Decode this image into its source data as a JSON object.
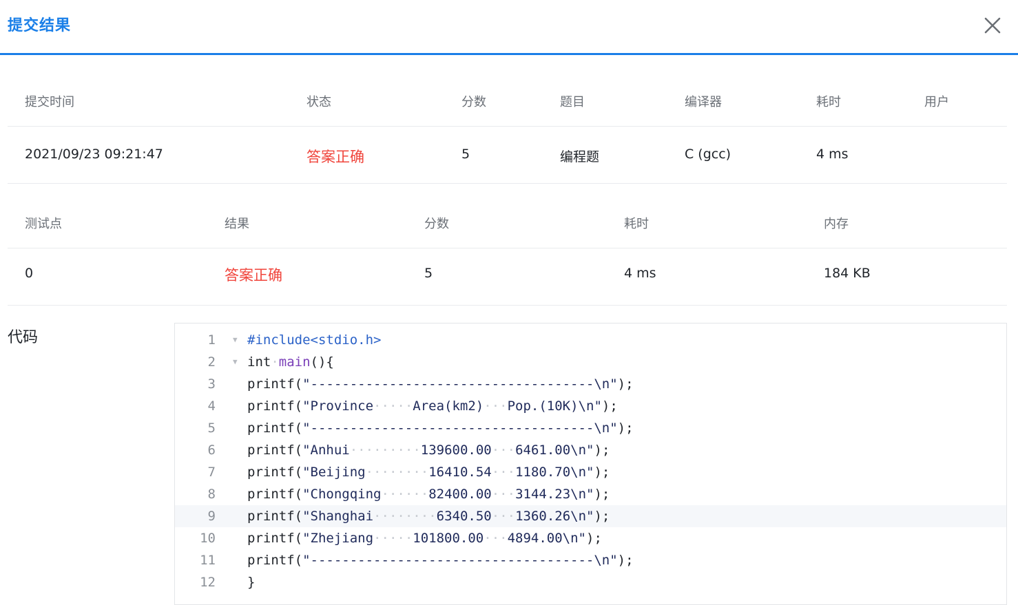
{
  "header": {
    "title": "提交结果",
    "close_icon": "close-icon"
  },
  "submission_table": {
    "columns": [
      "提交时间",
      "状态",
      "分数",
      "题目",
      "编译器",
      "耗时",
      "用户"
    ],
    "row": {
      "time": "2021/09/23 09:21:47",
      "status": "答案正确",
      "score": "5",
      "problem": "编程题",
      "compiler": "C (gcc)",
      "duration": "4 ms",
      "user": ""
    }
  },
  "testcase_table": {
    "columns": [
      "测试点",
      "结果",
      "分数",
      "耗时",
      "内存"
    ],
    "row": {
      "case": "0",
      "result": "答案正确",
      "score": "5",
      "duration": "4 ms",
      "memory": "184 KB"
    }
  },
  "code": {
    "label": "代码",
    "active_line": 9,
    "lines": [
      "#include<stdio.h>",
      "int main(){",
      "printf(\"------------------------------------\\n\");",
      "printf(\"Province     Area(km2)   Pop.(10K)\\n\");",
      "printf(\"------------------------------------\\n\");",
      "printf(\"Anhui         139600.00   6461.00\\n\");",
      "printf(\"Beijing        16410.54   1180.70\\n\");",
      "printf(\"Chongqing      82400.00   3144.23\\n\");",
      "printf(\"Shanghai        6340.50   1360.26\\n\");",
      "printf(\"Zhejiang     101800.00   4894.00\\n\");",
      "printf(\"------------------------------------\\n\");",
      "}"
    ]
  },
  "colors": {
    "accent": "#1a7fe8",
    "status_correct": "#f0443b"
  }
}
